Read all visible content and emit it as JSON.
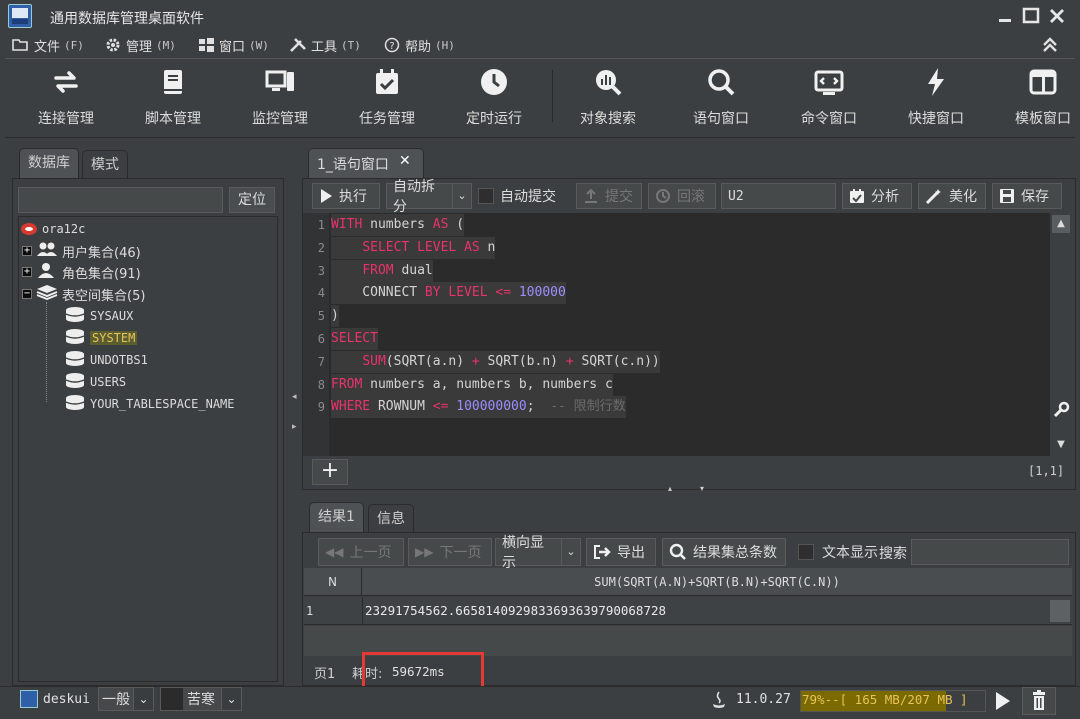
{
  "window": {
    "title": "通用数据库管理桌面软件",
    "controls": [
      "minimize",
      "maximize",
      "close"
    ]
  },
  "menu": [
    {
      "icon": "folder-open-icon",
      "label": "文件",
      "shortcut": "(F)"
    },
    {
      "icon": "gear-icon",
      "label": "管理",
      "shortcut": "(M)"
    },
    {
      "icon": "windows-icon",
      "label": "窗口",
      "shortcut": "(W)"
    },
    {
      "icon": "tools-icon",
      "label": "工具",
      "shortcut": "(T)"
    },
    {
      "icon": "help-icon",
      "label": "帮助",
      "shortcut": "(H)"
    }
  ],
  "toolbar": [
    {
      "icon": "connection-icon",
      "label": "连接管理"
    },
    {
      "icon": "script-book-icon",
      "label": "脚本管理"
    },
    {
      "icon": "monitor-icon",
      "label": "监控管理"
    },
    {
      "icon": "calendar-check-icon",
      "label": "任务管理"
    },
    {
      "icon": "clock-icon",
      "label": "定时运行"
    },
    {
      "icon": "object-search-icon",
      "label": "对象搜索"
    },
    {
      "icon": "search-icon",
      "label": "语句窗口"
    },
    {
      "icon": "command-window-icon",
      "label": "命令窗口"
    },
    {
      "icon": "lightning-icon",
      "label": "快捷窗口"
    },
    {
      "icon": "template-window-icon",
      "label": "模板窗口"
    }
  ],
  "left_panel": {
    "tabs": [
      "数据库",
      "模式"
    ],
    "active_tab": "数据库",
    "locate_button": "定位",
    "tree": {
      "root": "ora12c",
      "groups": [
        {
          "label": "用户集合(46)",
          "expanded": false
        },
        {
          "label": "角色集合(91)",
          "expanded": false
        },
        {
          "label": "表空间集合(5)",
          "expanded": true
        }
      ],
      "tablespaces": [
        "SYSAUX",
        "SYSTEM",
        "UNDOTBS1",
        "USERS",
        "YOUR_TABLESPACE_NAME"
      ],
      "selected": "SYSTEM"
    }
  },
  "editor": {
    "tab_label": "1_语句窗口",
    "toolbar": {
      "execute": "执行",
      "auto_split": "自动拆分",
      "auto_commit": "自动提交",
      "commit": "提交",
      "rollback": "回滚",
      "schema": "U2",
      "analyze": "分析",
      "beautify": "美化",
      "save": "保存"
    },
    "line_numbers": [
      "1",
      "2",
      "3",
      "4",
      "5",
      "6",
      "7",
      "8",
      "9"
    ],
    "code_lines": [
      [
        {
          "t": "WITH",
          "c": "kw"
        },
        {
          "t": " numbers ",
          "c": ""
        },
        {
          "t": "AS",
          "c": "kw"
        },
        {
          "t": " (",
          "c": ""
        }
      ],
      [
        {
          "t": "    ",
          "c": ""
        },
        {
          "t": "SELECT",
          "c": "kw"
        },
        {
          "t": " ",
          "c": ""
        },
        {
          "t": "LEVEL",
          "c": "kw"
        },
        {
          "t": " ",
          "c": ""
        },
        {
          "t": "AS",
          "c": "kw"
        },
        {
          "t": " n",
          "c": ""
        }
      ],
      [
        {
          "t": "    ",
          "c": ""
        },
        {
          "t": "FROM",
          "c": "kw"
        },
        {
          "t": " dual",
          "c": ""
        }
      ],
      [
        {
          "t": "    CONNECT ",
          "c": ""
        },
        {
          "t": "BY",
          "c": "kw"
        },
        {
          "t": " ",
          "c": ""
        },
        {
          "t": "LEVEL",
          "c": "kw"
        },
        {
          "t": " ",
          "c": ""
        },
        {
          "t": "<=",
          "c": "kw"
        },
        {
          "t": " ",
          "c": ""
        },
        {
          "t": "100000",
          "c": "num"
        }
      ],
      [
        {
          "t": ")",
          "c": ""
        }
      ],
      [
        {
          "t": "SELECT",
          "c": "kw"
        }
      ],
      [
        {
          "t": "    ",
          "c": ""
        },
        {
          "t": "SUM",
          "c": "kw"
        },
        {
          "t": "(SQRT(a.n) ",
          "c": ""
        },
        {
          "t": "+",
          "c": "kw"
        },
        {
          "t": " SQRT(b.n) ",
          "c": ""
        },
        {
          "t": "+",
          "c": "kw"
        },
        {
          "t": " SQRT(c.n))",
          "c": ""
        }
      ],
      [
        {
          "t": "FROM",
          "c": "kw"
        },
        {
          "t": " numbers a, numbers b, numbers c",
          "c": ""
        }
      ],
      [
        {
          "t": "WHERE",
          "c": "kw"
        },
        {
          "t": " ROWNUM ",
          "c": ""
        },
        {
          "t": "<=",
          "c": "kw"
        },
        {
          "t": " ",
          "c": ""
        },
        {
          "t": "100000000",
          "c": "num"
        },
        {
          "t": ";  ",
          "c": ""
        },
        {
          "t": "-- 限制行数",
          "c": "cmt"
        }
      ]
    ],
    "cursor_position": "[1,1]"
  },
  "results": {
    "tabs": [
      "结果1",
      "信息"
    ],
    "active_tab": "结果1",
    "toolbar": {
      "prev_page": "上一页",
      "next_page": "下一页",
      "display_mode": "横向显示",
      "export": "导出",
      "total_count": "结果集总条数",
      "text_display": "文本显示",
      "search": "搜索"
    },
    "columns": [
      "N",
      "SUM(SQRT(A.N)+SQRT(B.N)+SQRT(C.N))"
    ],
    "rows": [
      [
        "1",
        "23291754562.6658140929833693639790068728"
      ]
    ],
    "status": {
      "page": "页1",
      "elapsed_label": "耗时:",
      "elapsed_value": "59672ms"
    }
  },
  "statusbar": {
    "user": "deskui",
    "mode": "一般",
    "theme": "苦寒",
    "java_version": "11.0.27",
    "memory_text": "79%--[ 165 MB/207 MB ]",
    "memory_fraction": 0.79
  },
  "colors": {
    "background": "#3c3f41",
    "editor_bg": "#2b2b2b",
    "keyword": "#e8336b",
    "number": "#9b8fff",
    "selected_text": "#e8c35a",
    "highlight_box": "#e53935",
    "memory_bar": "#7a6a00"
  }
}
